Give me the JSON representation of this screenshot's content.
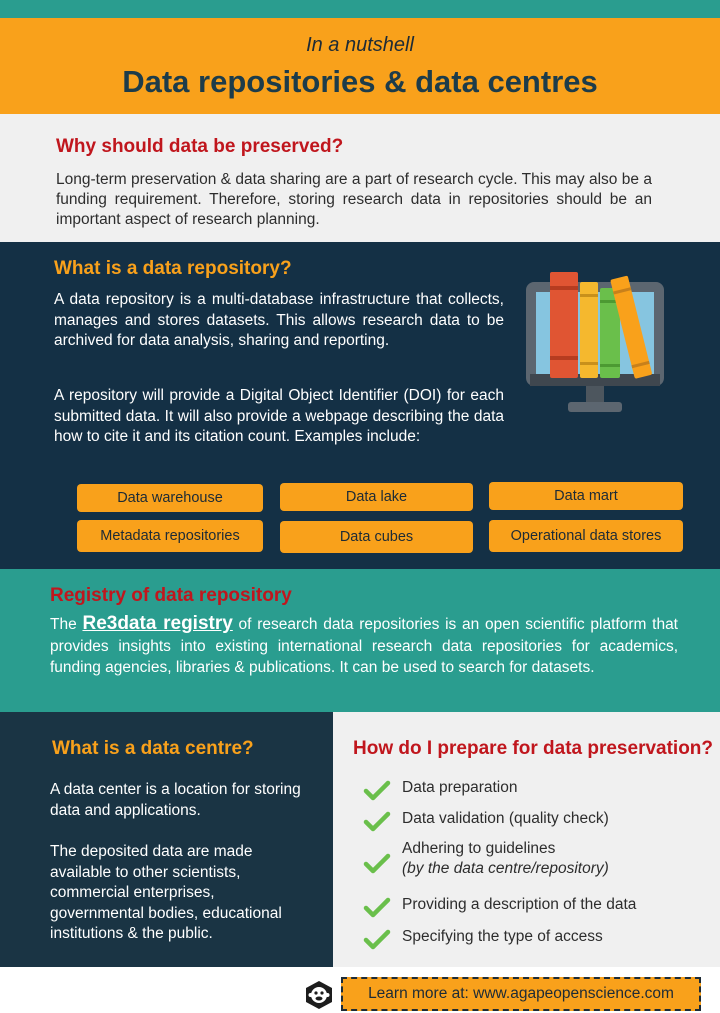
{
  "header": {
    "subtitle": "In a nutshell",
    "title": "Data repositories & data centres"
  },
  "why": {
    "heading": "Why should data be preserved?",
    "text": "Long-term preservation & data sharing are a part of research cycle. This may also be a funding requirement. Therefore, storing research data in repositories should be an important aspect of research planning."
  },
  "repository": {
    "heading": "What is a data repository?",
    "para1": "A data repository is a multi-database infrastructure that collects, manages and stores datasets. This allows research data to be archived for data analysis, sharing and reporting.",
    "para2": "A repository will provide a Digital Object Identifier (DOI) for each submitted data. It will also provide a webpage describing the data how to cite it and its citation count. Examples include:",
    "examples": [
      "Data warehouse",
      "Data lake",
      "Data mart",
      "Metadata repositories",
      "Data cubes",
      "Operational data stores"
    ],
    "illustration_icon": "books-on-monitor-icon"
  },
  "registry": {
    "heading": "Registry of data repository",
    "prefix": "The",
    "link": "Re3data registry",
    "text": " of research data repositories is an open scientific platform that provides insights into existing international research data repositories for academics, funding agencies, libraries & publications. It can be used to search for datasets."
  },
  "centre": {
    "heading": "What is a data centre?",
    "para1": "A data center is a location for storing data and applications.",
    "para2": "The deposited data are made available to other scientists, commercial enterprises, governmental bodies, educational institutions & the public."
  },
  "prepare": {
    "heading": "How do I prepare for data preservation?",
    "steps": [
      {
        "label": "Data preparation",
        "note": ""
      },
      {
        "label": "Data validation (quality check)",
        "note": ""
      },
      {
        "label": "Adhering to guidelines",
        "note": "(by the data centre/repository)"
      },
      {
        "label": "Providing a description of the data",
        "note": ""
      },
      {
        "label": "Specifying the type of access",
        "note": ""
      }
    ],
    "step_icon": "checkmark-icon"
  },
  "footer": {
    "text": "Learn more at: www.agapeopenscience.com",
    "logo_icon": "monkey-logo-icon"
  },
  "colors": {
    "teal": "#2a9d8f",
    "orange": "#f9a11b",
    "navy": "#143045",
    "red": "#c0161d",
    "check_green": "#6abf4b"
  }
}
